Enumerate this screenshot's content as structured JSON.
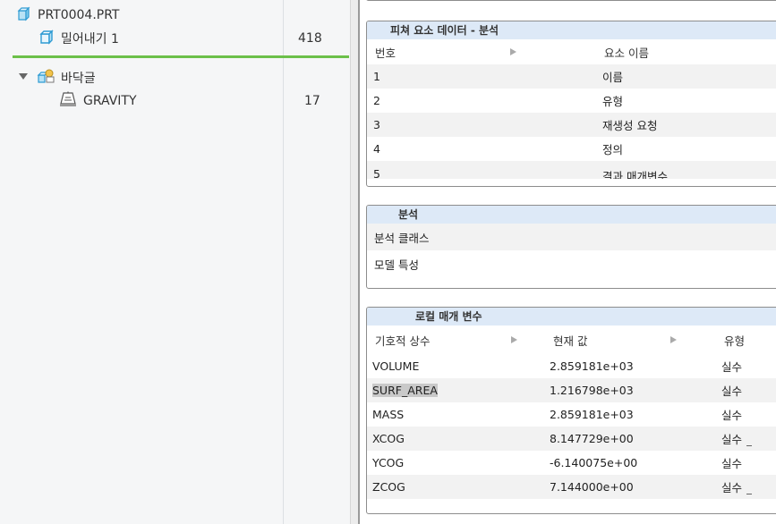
{
  "tree": {
    "part_name": "PRT0004.PRT",
    "items": [
      {
        "label": "밀어내기 1",
        "count": "418"
      },
      {
        "label": "바닥글",
        "count": ""
      },
      {
        "label": "GRAVITY",
        "count": "17"
      }
    ]
  },
  "feature_panel": {
    "title": "피쳐 요소 데이터 - 분석",
    "columns": [
      "번호",
      "요소 이름"
    ],
    "rows": [
      {
        "num": "1",
        "name": "이름"
      },
      {
        "num": "2",
        "name": "유형"
      },
      {
        "num": "3",
        "name": "재생성 요청"
      },
      {
        "num": "4",
        "name": "정의"
      },
      {
        "num": "5",
        "name": "결과 매개변수"
      }
    ]
  },
  "analysis_panel": {
    "title": "분석",
    "rows": [
      "분석 클래스",
      "모델 특성"
    ]
  },
  "params_panel": {
    "title": "로컬 매개 변수",
    "columns": [
      "기호적 상수",
      "현재 값",
      "유형"
    ],
    "rows": [
      {
        "symbol": "VOLUME",
        "value": "2.859181e+03",
        "type": "실수"
      },
      {
        "symbol": "SURF_AREA",
        "value": "1.216798e+03",
        "type": "실수"
      },
      {
        "symbol": "MASS",
        "value": "2.859181e+03",
        "type": "실수"
      },
      {
        "symbol": "XCOG",
        "value": "8.147729e+00",
        "type": "실수"
      },
      {
        "symbol": "YCOG",
        "value": "-6.140075e+00",
        "type": "실수"
      },
      {
        "symbol": "ZCOG",
        "value": "7.144000e+00",
        "type": "실수"
      }
    ]
  },
  "colors": {
    "accent_green": "#6cc04a",
    "panel_header": "#dde9f7",
    "part_icon": "#3aa6d8"
  },
  "icons": [
    "part-icon",
    "extrude-icon",
    "expand-arrow-icon",
    "analysis-folder-icon",
    "gravity-scale-icon"
  ]
}
